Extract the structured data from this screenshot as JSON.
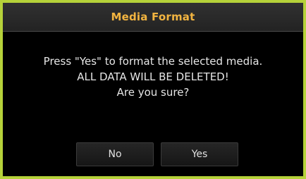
{
  "dialog": {
    "title": "Media Format",
    "message_lines": [
      "Press \"Yes\" to format the selected media.",
      "ALL DATA WILL BE DELETED!",
      "Are you sure?"
    ],
    "buttons": {
      "no_label": "No",
      "yes_label": "Yes"
    }
  },
  "colors": {
    "border": "#b6d23a",
    "title": "#f2b440",
    "background": "#000000",
    "text": "#e6e6e6"
  }
}
